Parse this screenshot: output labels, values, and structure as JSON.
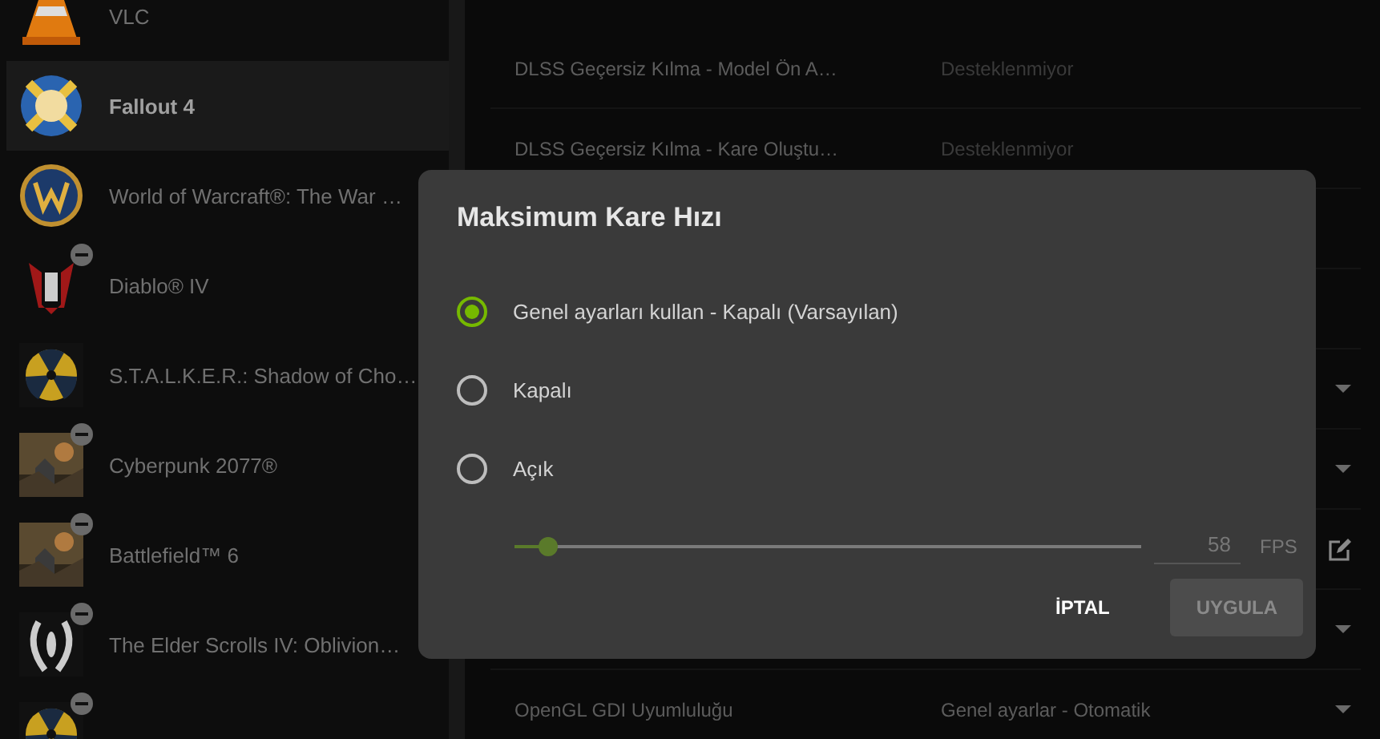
{
  "games": [
    {
      "name": "VLC",
      "kind": "cone",
      "selected": false,
      "badge": false
    },
    {
      "name": "Fallout 4",
      "kind": "vault",
      "selected": true,
      "badge": false
    },
    {
      "name": "World of Warcraft®: The War …",
      "kind": "emblem",
      "selected": false,
      "badge": false
    },
    {
      "name": "Diablo® IV",
      "kind": "demon",
      "selected": false,
      "badge": true
    },
    {
      "name": "S.T.A.L.K.E.R.: Shadow of Cho…",
      "kind": "radiation",
      "selected": false,
      "badge": false
    },
    {
      "name": "Cyberpunk 2077®",
      "kind": "picture",
      "selected": false,
      "badge": true
    },
    {
      "name": "Battlefield™ 6",
      "kind": "picture",
      "selected": false,
      "badge": true
    },
    {
      "name": "The Elder Scrolls IV: Oblivion…",
      "kind": "eye",
      "selected": false,
      "badge": true
    },
    {
      "kind": "radiation",
      "selected": false,
      "badge": true
    }
  ],
  "settings": [
    {
      "label": "DLSS Geçersiz Kılma - Model Ön A…",
      "value": "Desteklenmiyor",
      "disabled": true,
      "kind": "plain"
    },
    {
      "label": "DLSS Geçersiz Kılma - Kare Oluştu…",
      "value": "Desteklenmiyor",
      "disabled": true,
      "kind": "plain"
    },
    {
      "kind": "plain"
    },
    {
      "kind": "plain"
    },
    {
      "kind": "dropdown"
    },
    {
      "kind": "dropdown"
    },
    {
      "kind": "edit"
    },
    {
      "kind": "dropdown"
    },
    {
      "label": "OpenGL GDI Uyumluluğu",
      "value": "Genel ayarlar - Otomatik",
      "disabled": false,
      "kind": "dropdown"
    }
  ],
  "dialog": {
    "title": "Maksimum Kare Hızı",
    "options": [
      {
        "label": "Genel ayarları kullan - Kapalı (Varsayılan)",
        "selected": true
      },
      {
        "label": "Kapalı",
        "selected": false
      },
      {
        "label": "Açık",
        "selected": false
      }
    ],
    "slider": {
      "level": 0.04,
      "value": "58",
      "unit": "FPS",
      "disabled": true
    },
    "buttons": [
      {
        "label": "İPTAL",
        "disabled": false
      },
      {
        "label": "UYGULA",
        "disabled": true
      }
    ]
  }
}
